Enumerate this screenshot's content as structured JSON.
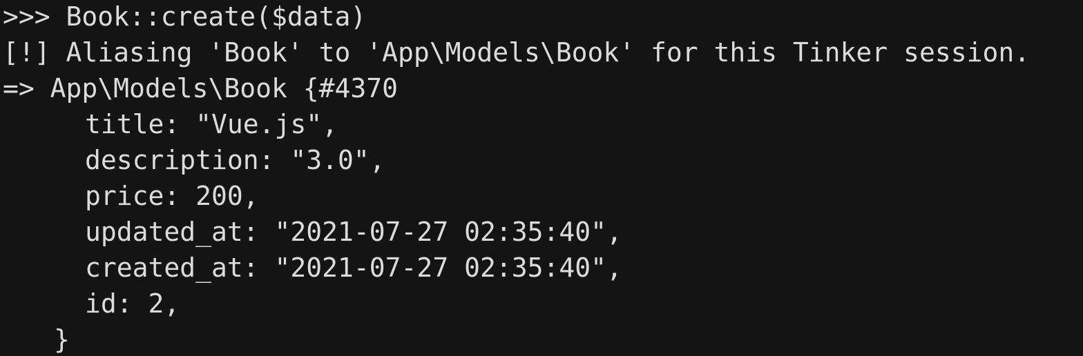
{
  "terminal": {
    "prompt": ">>>",
    "command": "Book::create($data)",
    "warning_tag": "[!]",
    "warning_text": "Aliasing 'Book' to 'App\\Models\\Book' for this Tinker session.",
    "result_arrow": "=>",
    "result_header": "App\\Models\\Book {#4370",
    "properties": [
      "title: \"Vue.js\",",
      "description: \"3.0\",",
      "price: 200,",
      "updated_at: \"2021-07-27 02:35:40\",",
      "created_at: \"2021-07-27 02:35:40\",",
      "id: 2,"
    ],
    "closing": "}"
  },
  "colors": {
    "background": "#141414",
    "text": "#dcdcdc"
  }
}
